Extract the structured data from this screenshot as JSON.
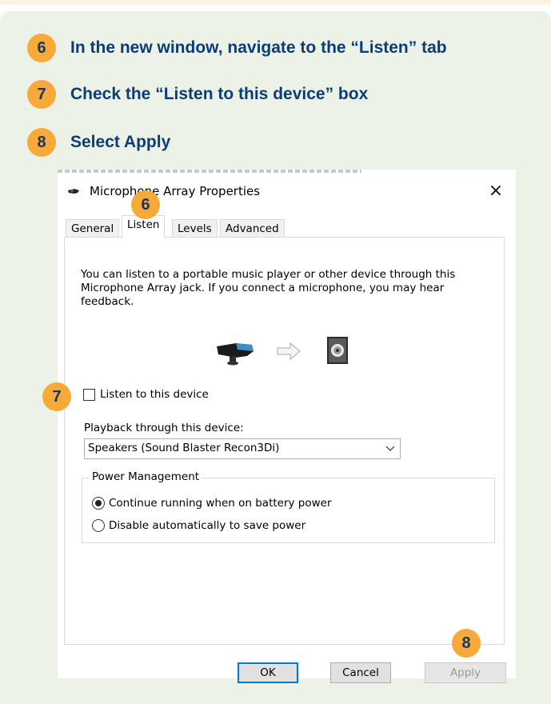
{
  "steps": [
    {
      "number": "6",
      "text": "In the new window, navigate to the “Listen” tab"
    },
    {
      "number": "7",
      "text": "Check the “Listen to this device” box"
    },
    {
      "number": "8",
      "text": "Select Apply"
    }
  ],
  "dialog": {
    "title": "Microphone Array Properties",
    "close_glyph": "×",
    "tabs": [
      "General",
      "Listen",
      "Levels",
      "Advanced"
    ],
    "active_tab": "Listen",
    "description": "You can listen to a portable music player or other device through this Microphone Array jack.  If you connect a microphone, you may hear feedback.",
    "listen_checkbox_label": "Listen to this device",
    "listen_checked": false,
    "playback_label": "Playback through this device:",
    "playback_selected": "Speakers (Sound Blaster Recon3Di)",
    "power_group_title": "Power Management",
    "power_options": [
      "Continue running when on battery power",
      "Disable automatically to save power"
    ],
    "power_selected_index": 0,
    "buttons": {
      "ok": "OK",
      "cancel": "Cancel",
      "apply": "Apply"
    }
  },
  "overlay_badges": {
    "tab": "6",
    "checkbox": "7",
    "apply": "8"
  },
  "colors": {
    "badge": "#f7a93a",
    "step_text": "#0b3c78",
    "panel_bg": "#ecf3e6",
    "top_strip": "#fdf3e1"
  }
}
